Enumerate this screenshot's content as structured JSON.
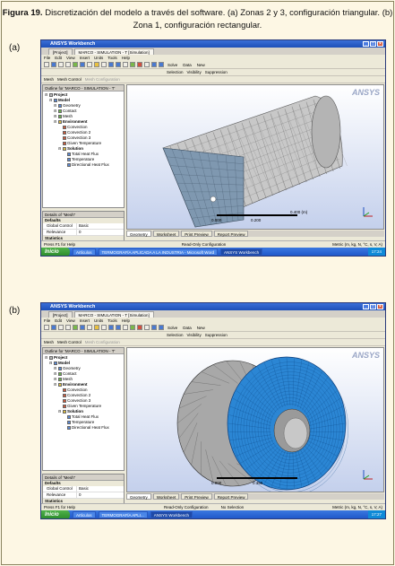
{
  "caption": {
    "figure": "Figura 19.",
    "text": " Discretización del modelo a través del software. (a) Zonas 2 y 3, configuración triangular. (b) Zona 1, configuración rectangular."
  },
  "panels": [
    {
      "label": "(a)",
      "window_title": "ANSYS Workbench",
      "tabs": [
        "[Project]",
        "MARCO - SIMULATION - T [Simulation]"
      ],
      "menu": [
        "File",
        "Edit",
        "View",
        "Insert",
        "Units",
        "Tools",
        "Help"
      ],
      "toolbar_texts": [
        "Solve",
        "Data",
        "New",
        "Selection",
        "Visibility",
        "Suppression"
      ],
      "mesh_bar": [
        "Mesh",
        "Mesh Control",
        "Mesh Configuration"
      ],
      "outline_title": "Outline for 'MARCO - SIMULATION - T'",
      "tree": [
        {
          "label": "Project",
          "level": 0,
          "icon": "gray",
          "bold": true
        },
        {
          "label": "Model",
          "level": 1,
          "icon": "blue",
          "bold": true
        },
        {
          "label": "Geometry",
          "level": 2,
          "icon": "blue",
          "bold": false
        },
        {
          "label": "Contact",
          "level": 2,
          "icon": "green",
          "bold": false
        },
        {
          "label": "Mesh",
          "level": 2,
          "icon": "green",
          "bold": false
        },
        {
          "label": "Environment",
          "level": 2,
          "icon": "yel",
          "bold": true
        },
        {
          "label": "Convection",
          "level": 3,
          "icon": "red",
          "bold": false
        },
        {
          "label": "Convection 2",
          "level": 3,
          "icon": "red",
          "bold": false
        },
        {
          "label": "Convection 3",
          "level": 3,
          "icon": "red",
          "bold": false
        },
        {
          "label": "Given Temperature",
          "level": 3,
          "icon": "red",
          "bold": false
        },
        {
          "label": "Solution",
          "level": 3,
          "icon": "yel",
          "bold": true
        },
        {
          "label": "Total Heat Flux",
          "level": 4,
          "icon": "blue",
          "bold": false
        },
        {
          "label": "Temperature",
          "level": 4,
          "icon": "blue",
          "bold": false
        },
        {
          "label": "Directional Heat Flux",
          "level": 4,
          "icon": "blue",
          "bold": false
        }
      ],
      "details_title": "Details of \"Mesh\"",
      "defaults_label": "Defaults",
      "details_rows": [
        {
          "k": "Global Control",
          "v": "Basic"
        },
        {
          "k": "Relevance",
          "v": "0"
        }
      ],
      "statistics_label": "Statistics",
      "view_tabs": [
        "Geometry",
        "Worksheet",
        "Print Preview",
        "Report Preview"
      ],
      "scale_labels": [
        "0.000",
        "0.200",
        "0.400 (m)"
      ],
      "status_left": "Press F1 for Help",
      "status_mid": "Read-Only Configuration",
      "status_right": "Metric (m, kg, N, °C, s, V, A)",
      "taskbar_start": "Inicio",
      "taskbar_items": [
        "Artículos",
        "TERMOGRAFÍA APLICADA A LA INDUSTRIA - Microsoft Word",
        "ANSYS Workbench"
      ],
      "clock": "17:24",
      "watermark": "ANSYS"
    },
    {
      "label": "(b)",
      "window_title": "ANSYS Workbench",
      "tabs": [
        "[Project]",
        "MARCO - SIMULATION - T [Simulation]"
      ],
      "menu": [
        "File",
        "Edit",
        "View",
        "Insert",
        "Units",
        "Tools",
        "Help"
      ],
      "toolbar_texts": [
        "Solve",
        "Data",
        "New",
        "Selection",
        "Visibility",
        "Suppression"
      ],
      "mesh_bar": [
        "Mesh",
        "Mesh Control",
        "Mesh Configuration"
      ],
      "outline_title": "Outline for 'MARCO - SIMULATION - T'",
      "tree": [
        {
          "label": "Project",
          "level": 0,
          "icon": "gray",
          "bold": true
        },
        {
          "label": "Model",
          "level": 1,
          "icon": "blue",
          "bold": true
        },
        {
          "label": "Geometry",
          "level": 2,
          "icon": "blue",
          "bold": false
        },
        {
          "label": "Contact",
          "level": 2,
          "icon": "green",
          "bold": false
        },
        {
          "label": "Mesh",
          "level": 2,
          "icon": "green",
          "bold": false
        },
        {
          "label": "Environment",
          "level": 2,
          "icon": "yel",
          "bold": true
        },
        {
          "label": "Convection",
          "level": 3,
          "icon": "red",
          "bold": false
        },
        {
          "label": "Convection 2",
          "level": 3,
          "icon": "red",
          "bold": false
        },
        {
          "label": "Convection 3",
          "level": 3,
          "icon": "red",
          "bold": false
        },
        {
          "label": "Given Temperature",
          "level": 3,
          "icon": "red",
          "bold": false
        },
        {
          "label": "Solution",
          "level": 3,
          "icon": "yel",
          "bold": true
        },
        {
          "label": "Total Heat Flux",
          "level": 4,
          "icon": "blue",
          "bold": false
        },
        {
          "label": "Temperature",
          "level": 4,
          "icon": "blue",
          "bold": false
        },
        {
          "label": "Directional Heat Flux",
          "level": 4,
          "icon": "blue",
          "bold": false
        }
      ],
      "details_title": "Details of \"Mesh\"",
      "defaults_label": "Defaults",
      "details_rows": [
        {
          "k": "Global Control",
          "v": "Basic"
        },
        {
          "k": "Relevance",
          "v": "0"
        }
      ],
      "statistics_label": "Statistics",
      "view_tabs": [
        "Geometry",
        "Worksheet",
        "Print Preview",
        "Report Preview"
      ],
      "scale_labels": [
        "0.000",
        "0.350"
      ],
      "status_left": "Press F1 for Help",
      "status_mid": "Read-Only Configuration",
      "status_mid2": "No Selection",
      "status_right": "Metric (m, kg, N, °C, s, V, A)",
      "taskbar_start": "Inicio",
      "taskbar_items": [
        "Artículos",
        "TERMOGRAFÍA APLI...",
        "ANSYS Workbench"
      ],
      "clock": "17:27",
      "watermark": "ANSYS"
    }
  ],
  "colors": {
    "page_bg": "#fdf7e4",
    "mesh_gray": "#c8c8c8",
    "mesh_face": "#7f98b0",
    "mesh_blue": "#2b86d4"
  }
}
